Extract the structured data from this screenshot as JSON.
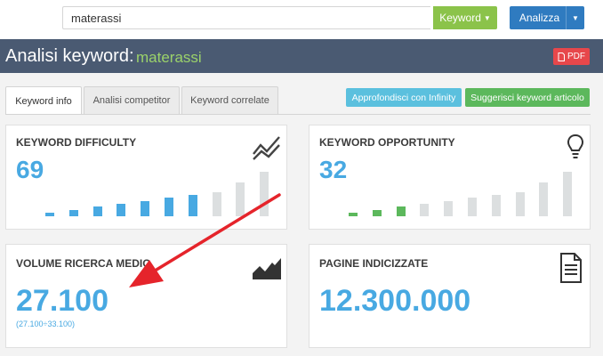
{
  "search": {
    "value": "materassi"
  },
  "toolbar": {
    "keyword_label": "Keyword",
    "analizza_label": "Analizza"
  },
  "header": {
    "title": "Analisi keyword:",
    "keyword": "materassi",
    "pdf_label": "PDF"
  },
  "tabs": [
    {
      "label": "Keyword info"
    },
    {
      "label": "Analisi competitor"
    },
    {
      "label": "Keyword correlate"
    }
  ],
  "actions": {
    "infinity_label": "Approfondisci con Infinity",
    "suggest_label": "Suggerisci keyword articolo"
  },
  "cards": {
    "difficulty": {
      "title": "KEYWORD DIFFICULTY",
      "value": "69",
      "score": 69,
      "bars_total": 10
    },
    "opportunity": {
      "title": "KEYWORD OPPORTUNITY",
      "value": "32",
      "score": 32,
      "bars_total": 10
    },
    "volume": {
      "title": "VOLUME RICERCA MEDIO",
      "value": "27.100",
      "range": "(27.100÷33.100)"
    },
    "pages": {
      "title": "PAGINE INDICIZZATE",
      "value": "12.300.000"
    }
  },
  "colors": {
    "accent_blue": "#48a9e2",
    "green": "#5cb85c",
    "header_bg": "#4a5a72",
    "arrow_red": "#e5242b"
  },
  "icons": [
    "chevron-down-icon",
    "pdf-icon",
    "trend-lines-icon",
    "lightbulb-icon",
    "area-chart-icon",
    "document-icon",
    "red-arrow-annotation"
  ]
}
